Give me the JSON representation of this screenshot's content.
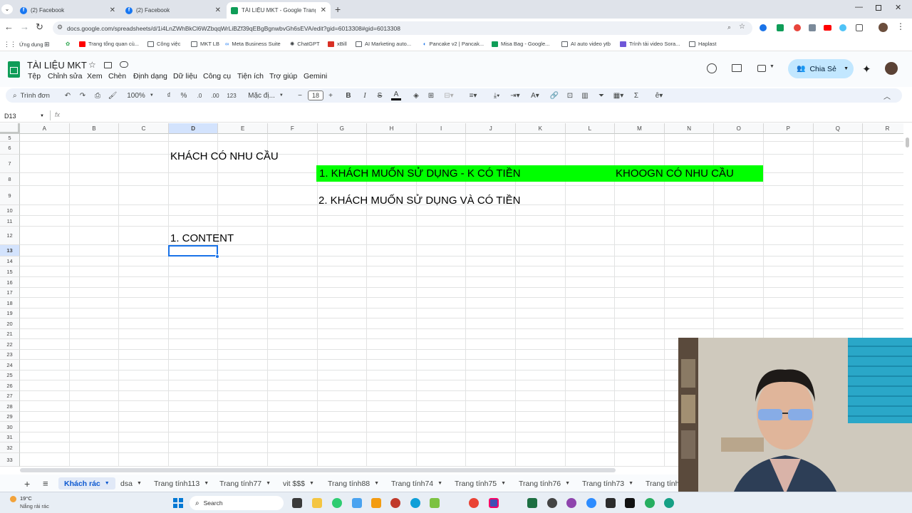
{
  "browser": {
    "tabs": [
      {
        "title": "(2) Facebook",
        "icon": "facebook-icon"
      },
      {
        "title": "(2) Facebook",
        "icon": "facebook-icon"
      },
      {
        "title": "TÀI LIỆU MKT - Google Trang tí",
        "icon": "sheets-icon",
        "active": true
      }
    ],
    "url": "docs.google.com/spreadsheets/d/1i4LnZWhBkCl6WZbqqWrLiBZf39qEBgBgnwbvGh6sEVA/edit?gid=6013308#gid=6013308",
    "bookmarks": [
      "Ứng dụng",
      "Trang tổng quan cù...",
      "Công việc",
      "MKT LB",
      "Meta Business Suite",
      "ChatGPT",
      "xBill",
      "AI Marketing auto...",
      "Pancake v2 | Pancak...",
      "Misa Bag - Google...",
      "AI auto video ytb",
      "Trình tải video Sora...",
      "Haplast"
    ]
  },
  "doc": {
    "title": "TÀI LIỆU MKT",
    "menu": [
      "Tệp",
      "Chỉnh sửa",
      "Xem",
      "Chèn",
      "Định dạng",
      "Dữ liệu",
      "Công cụ",
      "Tiện ích",
      "Trợ giúp",
      "Gemini"
    ],
    "share_label": "Chia Sẻ",
    "accent": "#c2e7ff"
  },
  "toolbar": {
    "search_label": "Trình đơn",
    "zoom": "100%",
    "currency": "₫",
    "percent": "%",
    "dec_less": ".0",
    "dec_more": ".00",
    "number_format": "123",
    "font": "Mặc đị...",
    "font_size": "18",
    "bold": "B",
    "italic": "I",
    "strike": "S",
    "text_color": "A",
    "sum": "Σ"
  },
  "formula_bar": {
    "cell_ref": "D13",
    "fx": "fx",
    "value": ""
  },
  "grid": {
    "columns": [
      "A",
      "B",
      "C",
      "D",
      "E",
      "F",
      "G",
      "H",
      "I",
      "J",
      "K",
      "L",
      "M",
      "N",
      "O",
      "P",
      "Q",
      "R"
    ],
    "rows": [
      "5",
      "6",
      "7",
      "8",
      "9",
      "10",
      "11",
      "12",
      "13",
      "14",
      "15",
      "16",
      "17",
      "18",
      "19",
      "20",
      "21",
      "22",
      "23",
      "24",
      "25",
      "26",
      "27",
      "28",
      "29",
      "30",
      "31",
      "32",
      "33"
    ],
    "selected_cell": "D13",
    "highlight_color": "#00ff00",
    "cells": {
      "d6": "KHÁCH CÓ NHU CẦU",
      "g7": "1. KHÁCH MUỐN SỬ DỤNG - K CÓ TIỀN",
      "m7": "KHOOGN CÓ NHU CẦU",
      "g9": "2. KHÁCH MUỐN SỬ DỤNG VÀ CÓ TIỀN",
      "d12": "1. CONTENT"
    }
  },
  "sheet_tabs": [
    "Khách rác",
    "dsa",
    "Trang tính113",
    "Trang tính77",
    "vit $$$",
    "Trang tính88",
    "Trang tính74",
    "Trang tính75",
    "Trang tính76",
    "Trang tính73",
    "Trang tính"
  ],
  "taskbar": {
    "weather_temp": "19°C",
    "weather_text": "Nắng rải rác",
    "search_label": "Search"
  }
}
